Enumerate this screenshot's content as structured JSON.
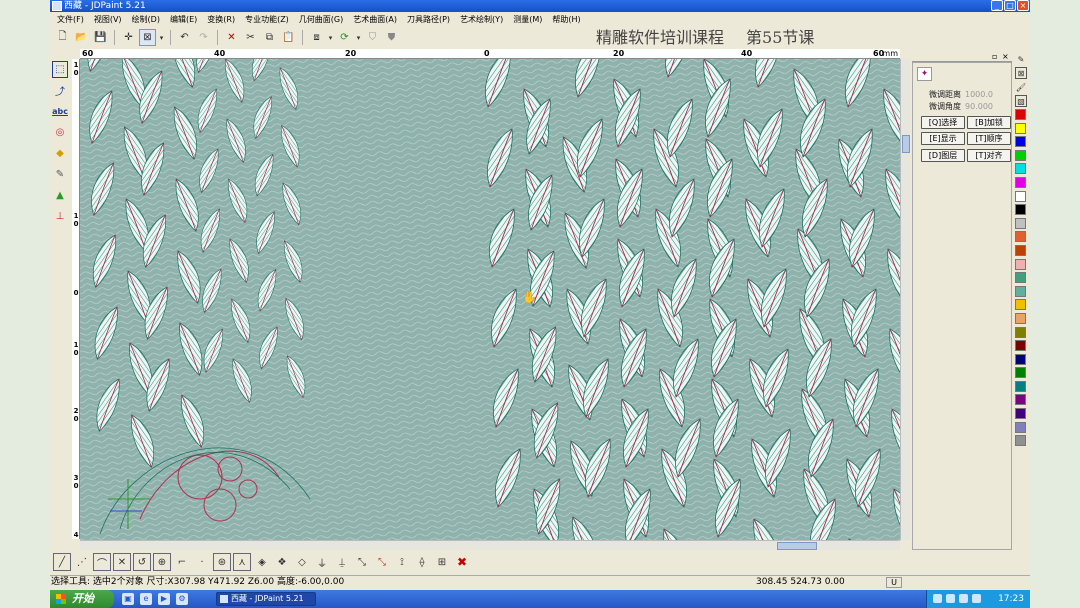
{
  "window": {
    "title": "西藏 - JDPaint 5.21",
    "buttons": [
      "_",
      "□",
      "×"
    ]
  },
  "menu": [
    "文件(F)",
    "视图(V)",
    "绘制(D)",
    "编辑(E)",
    "变换(R)",
    "专业功能(Z)",
    "几何曲面(G)",
    "艺术曲面(A)",
    "刀具路径(P)",
    "艺术绘制(Y)",
    "测量(M)",
    "帮助(H)"
  ],
  "heading": {
    "course": "精雕软件培训课程",
    "lesson": "第55节课"
  },
  "toolbar": {
    "icons": [
      "new-file-icon",
      "open-folder-icon",
      "save-icon",
      "crosshair-icon",
      "select-box-icon",
      "dropdown-arrow-icon",
      "undo-icon",
      "redo-icon",
      "delete-icon",
      "cut-icon",
      "copy-icon",
      "paste-icon",
      "group-icon",
      "dropdown-arrow-icon",
      "rotate-view-icon",
      "dropdown-arrow-icon",
      "shield-icon",
      "shield-filled-icon"
    ]
  },
  "left_tools": [
    "select-tool-icon",
    "node-edit-icon",
    "text-tool-icon",
    "circle-tool-icon",
    "paint-tool-icon",
    "pen-tool-icon",
    "fill-tool-icon",
    "measure-tool-icon"
  ],
  "ruler": {
    "h_ticks": [
      "60",
      "40",
      "20",
      "0",
      "20",
      "40",
      "60"
    ],
    "unit": "mm",
    "v_ticks": [
      "1 0",
      "1 0",
      "0",
      "1 0",
      "2 0",
      "3 0",
      "4"
    ]
  },
  "panel": {
    "tab_icon": "layers-icon",
    "fields": [
      {
        "label": "微调距离",
        "value": "1000.0"
      },
      {
        "label": "微调角度",
        "value": "90.000"
      }
    ],
    "buttons": [
      [
        "[Q]选择",
        "[B]加锁"
      ],
      [
        "[E]显示",
        "[T]顺序"
      ],
      [
        "[D]图层",
        "[T]对齐"
      ]
    ]
  },
  "colors": [
    "#e00000",
    "#ffff00",
    "#0000e0",
    "#00d000",
    "#00e0e0",
    "#e000e0",
    "#ffffff",
    "#000000",
    "#c0c0c0",
    "#e06030",
    "#c04000",
    "#f0b0b0",
    "#40a080",
    "#60b0a0",
    "#f0c000",
    "#f0a060",
    "#808000",
    "#800000",
    "#000080",
    "#008000",
    "#008080",
    "#800080",
    "#400080",
    "#8080c0",
    "#909090"
  ],
  "color_tools": [
    "pen-icon",
    "no-color-icon",
    "brush-icon",
    "hatch-icon",
    "arrow-up-icon",
    "arrow-down-icon"
  ],
  "bottom_tools": [
    "line-tool-icon",
    "point-tool-icon",
    "arc-tool-icon",
    "cross-tool-icon",
    "arc-ccw-tool-icon",
    "circle-center-icon",
    "tangent-tool-icon",
    "snap-point-icon",
    "trim-tool-icon",
    "rhombus-icon",
    "rhombus-fill-icon",
    "rhombus-cross-icon",
    "knife-icon",
    "knife-edit-icon",
    "cut-pointer-icon",
    "cut-pointer-red-icon",
    "tool-path-icon",
    "tool-path-edit-icon",
    "tool-path-grid-icon",
    "delete-red-icon"
  ],
  "status": {
    "left": "选择工具: 选中2个对象 尺寸:X307.98 Y471.92 Z6.00 高度:-6.00,0.00",
    "right": "308.45 524.73 0.00",
    "box": "U"
  },
  "taskbar": {
    "start": "开始",
    "task": "西藏 - JDPaint 5.21",
    "clock": "17:23"
  }
}
